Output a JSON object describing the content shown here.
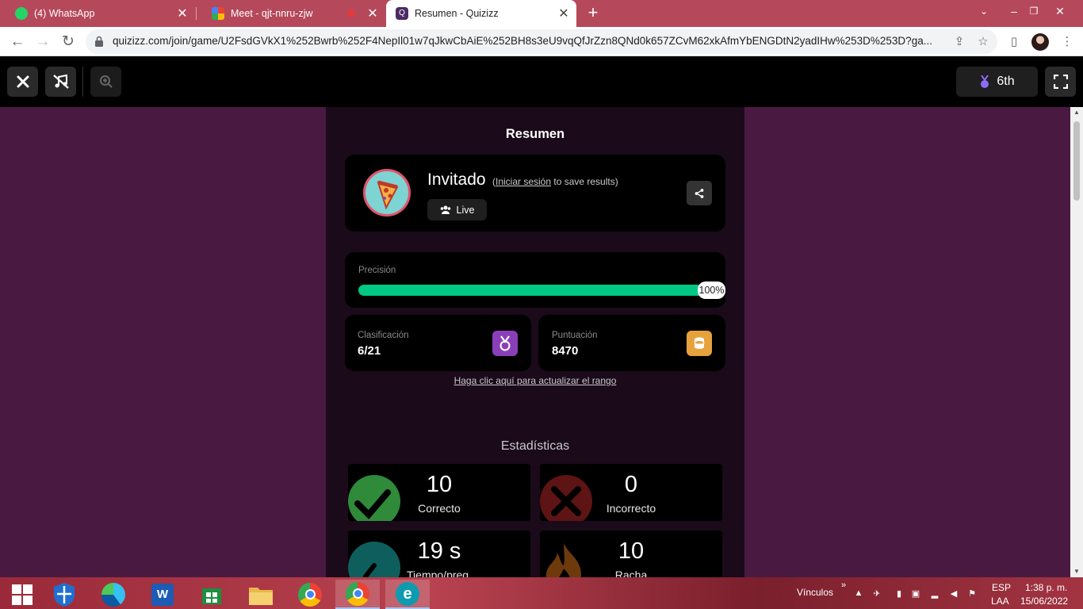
{
  "browser": {
    "tabs": [
      {
        "title": "(4) WhatsApp",
        "favicon": "whatsapp-icon"
      },
      {
        "title": "Meet - qjt-nnru-zjw",
        "favicon": "meet-icon"
      },
      {
        "title": "Resumen - Quizizz",
        "favicon": "quizizz-icon"
      }
    ],
    "url": "quizizz.com/join/game/U2FsdGVkX1%252Bwrb%252F4NepIl01w7qJkwCbAiE%252BH8s3eU9vqQfJrZzn8QNd0k657ZCvM62xkAfmYbENGDtN2yadIHw%253D%253D?ga..."
  },
  "quiz_bar": {
    "rank": "6th"
  },
  "summary": {
    "title": "Resumen",
    "user": {
      "name": "Invitado",
      "login_prefix": "(",
      "login_link": "Iniciar sesión",
      "login_suffix": " to save results)",
      "mode": "Live"
    },
    "accuracy": {
      "label": "Precisión",
      "percent": 100,
      "display": "100%"
    },
    "ranking": {
      "label": "Clasificación",
      "value": "6/21"
    },
    "score": {
      "label": "Puntuación",
      "value": "8470"
    },
    "update_link": "Haga clic aquí para actualizar el rango"
  },
  "stats": {
    "title": "Estadísticas",
    "items": [
      {
        "value": "10",
        "label": "Correcto",
        "icon": "checkmark-icon",
        "color": "#2f8a3a"
      },
      {
        "value": "0",
        "label": "Incorrecto",
        "icon": "x-icon",
        "color": "#7a1a1a"
      },
      {
        "value": "19 s",
        "label": "Tiempo/preg.",
        "icon": "stopwatch-icon",
        "color": "#0f6d6d"
      },
      {
        "value": "10",
        "label": "Racha",
        "icon": "flame-icon",
        "color": "#8a4a10"
      }
    ]
  },
  "taskbar": {
    "links_label": "Vínculos",
    "lang_top": "ESP",
    "lang_bottom": "LAA",
    "time": "1:38 p. m.",
    "date": "15/06/2022"
  },
  "colors": {
    "tabstrip": "#b5495b",
    "page_bg": "#4a1942",
    "accuracy_bar": "#00c985",
    "rank_badge": "#8a3fb8",
    "score_badge": "#e6a23c"
  }
}
